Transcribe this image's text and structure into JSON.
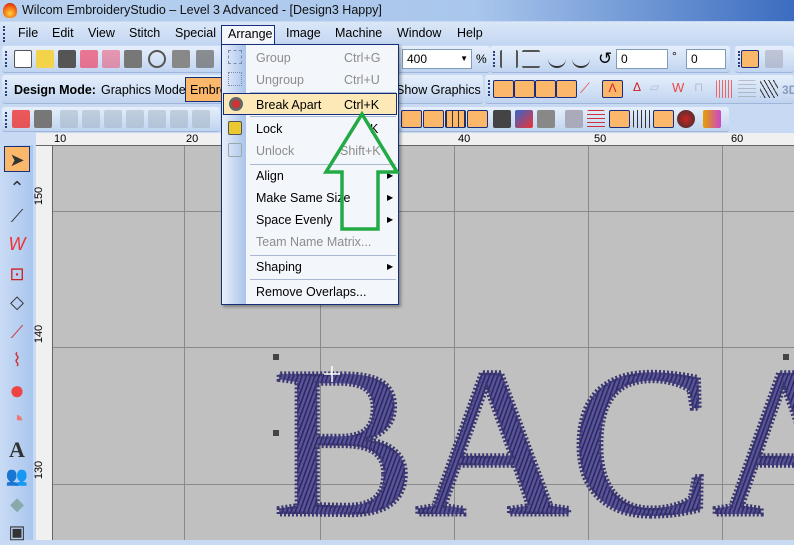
{
  "window": {
    "title": "Wilcom EmbroideryStudio – Level 3 Advanced - [Design3          Happy]"
  },
  "menubar": [
    "File",
    "Edit",
    "View",
    "Stitch",
    "Special",
    "Arrange",
    "Image",
    "Machine",
    "Window",
    "Help"
  ],
  "toolbar": {
    "zoom_value": "400",
    "zoom_unit": "%",
    "rotate_value": "0",
    "slant_value": "0",
    "degree": "°"
  },
  "design_mode": {
    "label": "Design Mode:",
    "graphics_mode": "Graphics Mode",
    "embroidery_mode": "Embroidery Mode",
    "show_graphics": "Show Graphics",
    "three_d": "3D"
  },
  "arrange_menu": [
    {
      "label": "Group",
      "shortcut": "Ctrl+G",
      "enabled": false,
      "icon": "group-icon"
    },
    {
      "label": "Ungroup",
      "shortcut": "Ctrl+U",
      "enabled": false,
      "icon": "ungroup-icon"
    },
    {
      "label": "Break Apart",
      "shortcut": "Ctrl+K",
      "enabled": true,
      "highlighted": true,
      "icon": "break-apart-icon"
    },
    {
      "label": "Lock",
      "shortcut": "K",
      "enabled": true,
      "icon": "lock-icon"
    },
    {
      "label": "Unlock",
      "shortcut": "Shift+K",
      "enabled": false,
      "icon": "unlock-icon"
    },
    {
      "label": "Align",
      "submenu": true,
      "enabled": true
    },
    {
      "label": "Make Same Size",
      "submenu": true,
      "enabled": true
    },
    {
      "label": "Space Evenly",
      "submenu": true,
      "enabled": true
    },
    {
      "label": "Team Name Matrix...",
      "enabled": false
    },
    {
      "label": "Shaping",
      "submenu": true,
      "enabled": true
    },
    {
      "label": "Remove Overlaps...",
      "enabled": true
    }
  ],
  "ruler": {
    "top": [
      "10",
      "20",
      "40",
      "50",
      "60"
    ],
    "left": [
      "150",
      "140",
      "130"
    ]
  },
  "design_text": "BACA",
  "colors": {
    "thread": "#4a4585",
    "accent": "#fbb76a",
    "arrow": "#22aa44",
    "selection": "#14307a"
  }
}
